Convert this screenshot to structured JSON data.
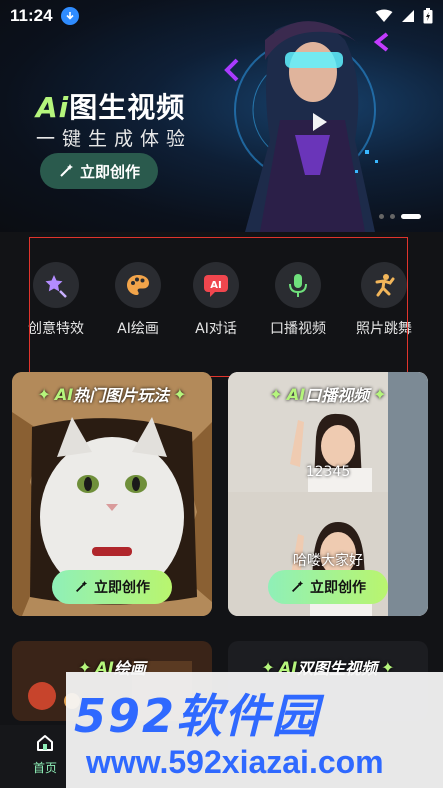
{
  "status_bar": {
    "time": "11:24"
  },
  "hero": {
    "title_ai": "Ai",
    "title_rest": "图生视频",
    "subtitle": "一键生成体验",
    "button_label": "立即创作"
  },
  "functions": [
    {
      "label": "创意特效",
      "icon": "magic-star-icon"
    },
    {
      "label": "AI绘画",
      "icon": "palette-icon"
    },
    {
      "label": "AI对话",
      "icon": "ai-chat-icon",
      "icon_text": "AI"
    },
    {
      "label": "口播视频",
      "icon": "microphone-icon"
    },
    {
      "label": "照片跳舞",
      "icon": "dance-icon"
    }
  ],
  "cards": [
    {
      "title_ai": "AI",
      "title_rest": "热门图片玩法",
      "button_label": "立即创作"
    },
    {
      "title_ai": "AI",
      "title_rest": "口播视频",
      "captions": [
        "12345",
        "哈喽大家好"
      ],
      "button_label": "立即创作"
    }
  ],
  "cards_row2": [
    {
      "title_ai": "AI",
      "title_rest": "绘画"
    },
    {
      "title_ai": "AI",
      "title_rest": "双图生视频"
    }
  ],
  "bottom_nav": {
    "home_label": "首页"
  },
  "watermark": {
    "line1": "592软件园",
    "line2": "www.592xiazai.com"
  },
  "colors": {
    "accent": "#b5f57c",
    "button_gradient_start": "#8ff0b8",
    "button_gradient_end": "#b9f56e",
    "highlight_box": "#e0342c"
  }
}
